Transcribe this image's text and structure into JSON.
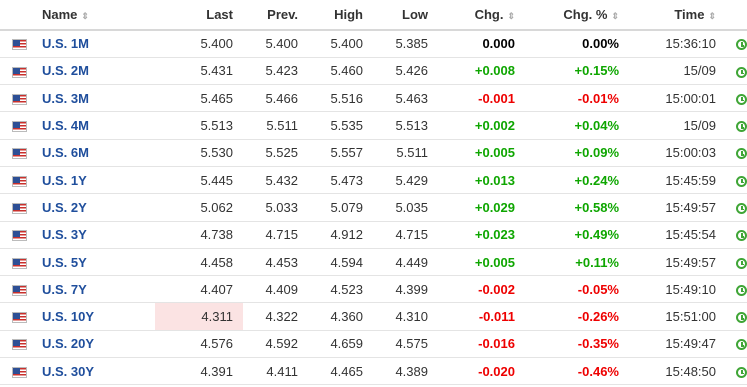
{
  "headers": {
    "name": "Name",
    "last": "Last",
    "prev": "Prev.",
    "high": "High",
    "low": "Low",
    "chg": "Chg.",
    "chg_pct": "Chg. %",
    "time": "Time",
    "sort_glyph": "⇕"
  },
  "colors": {
    "positive": "#0ea600",
    "negative": "#e00000",
    "link": "#1f4e9c",
    "highlight": "#fbe3e3"
  },
  "rows": [
    {
      "name": "U.S. 1M",
      "last": "5.400",
      "prev": "5.400",
      "high": "5.400",
      "low": "5.385",
      "chg": "0.000",
      "chg_pct": "0.00%",
      "time": "15:36:10",
      "dir": "zero"
    },
    {
      "name": "U.S. 2M",
      "last": "5.431",
      "prev": "5.423",
      "high": "5.460",
      "low": "5.426",
      "chg": "+0.008",
      "chg_pct": "+0.15%",
      "time": "15/09",
      "dir": "pos"
    },
    {
      "name": "U.S. 3M",
      "last": "5.465",
      "prev": "5.466",
      "high": "5.516",
      "low": "5.463",
      "chg": "-0.001",
      "chg_pct": "-0.01%",
      "time": "15:00:01",
      "dir": "neg"
    },
    {
      "name": "U.S. 4M",
      "last": "5.513",
      "prev": "5.511",
      "high": "5.535",
      "low": "5.513",
      "chg": "+0.002",
      "chg_pct": "+0.04%",
      "time": "15/09",
      "dir": "pos"
    },
    {
      "name": "U.S. 6M",
      "last": "5.530",
      "prev": "5.525",
      "high": "5.557",
      "low": "5.511",
      "chg": "+0.005",
      "chg_pct": "+0.09%",
      "time": "15:00:03",
      "dir": "pos"
    },
    {
      "name": "U.S. 1Y",
      "last": "5.445",
      "prev": "5.432",
      "high": "5.473",
      "low": "5.429",
      "chg": "+0.013",
      "chg_pct": "+0.24%",
      "time": "15:45:59",
      "dir": "pos"
    },
    {
      "name": "U.S. 2Y",
      "last": "5.062",
      "prev": "5.033",
      "high": "5.079",
      "low": "5.035",
      "chg": "+0.029",
      "chg_pct": "+0.58%",
      "time": "15:49:57",
      "dir": "pos"
    },
    {
      "name": "U.S. 3Y",
      "last": "4.738",
      "prev": "4.715",
      "high": "4.912",
      "low": "4.715",
      "chg": "+0.023",
      "chg_pct": "+0.49%",
      "time": "15:45:54",
      "dir": "pos"
    },
    {
      "name": "U.S. 5Y",
      "last": "4.458",
      "prev": "4.453",
      "high": "4.594",
      "low": "4.449",
      "chg": "+0.005",
      "chg_pct": "+0.11%",
      "time": "15:49:57",
      "dir": "pos"
    },
    {
      "name": "U.S. 7Y",
      "last": "4.407",
      "prev": "4.409",
      "high": "4.523",
      "low": "4.399",
      "chg": "-0.002",
      "chg_pct": "-0.05%",
      "time": "15:49:10",
      "dir": "neg"
    },
    {
      "name": "U.S. 10Y",
      "last": "4.311",
      "prev": "4.322",
      "high": "4.360",
      "low": "4.310",
      "chg": "-0.011",
      "chg_pct": "-0.26%",
      "time": "15:51:00",
      "dir": "neg",
      "highlight_last": true
    },
    {
      "name": "U.S. 20Y",
      "last": "4.576",
      "prev": "4.592",
      "high": "4.659",
      "low": "4.575",
      "chg": "-0.016",
      "chg_pct": "-0.35%",
      "time": "15:49:47",
      "dir": "neg"
    },
    {
      "name": "U.S. 30Y",
      "last": "4.391",
      "prev": "4.411",
      "high": "4.465",
      "low": "4.389",
      "chg": "-0.020",
      "chg_pct": "-0.46%",
      "time": "15:48:50",
      "dir": "neg"
    }
  ]
}
